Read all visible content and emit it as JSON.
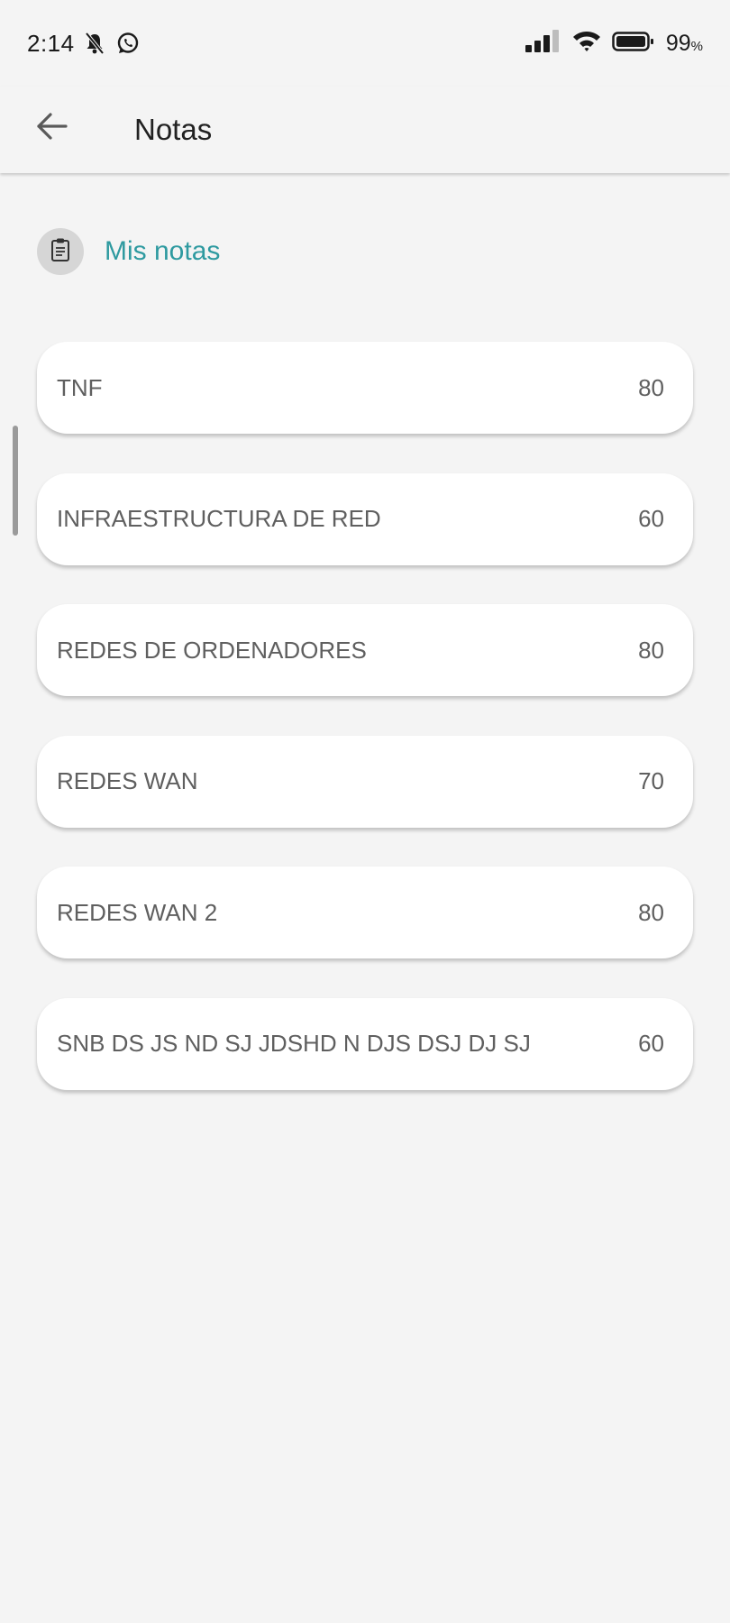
{
  "status_bar": {
    "time": "2:14",
    "battery_value": "99",
    "battery_unit": "%",
    "icons": [
      "bell-off-icon",
      "whatsapp-icon",
      "signal-icon",
      "wifi-icon",
      "battery-icon"
    ]
  },
  "app_bar": {
    "title": "Notas",
    "back_icon": "arrow-left-icon"
  },
  "section": {
    "title": "Mis notas",
    "icon": "clipboard-icon",
    "accent_color": "#2e9aa0"
  },
  "notes": [
    {
      "subject": "TNF",
      "grade": "80"
    },
    {
      "subject": "INFRAESTRUCTURA DE RED",
      "grade": "60"
    },
    {
      "subject": "REDES DE ORDENADORES",
      "grade": "80"
    },
    {
      "subject": "REDES WAN",
      "grade": "70"
    },
    {
      "subject": "REDES WAN 2",
      "grade": "80"
    },
    {
      "subject": "SNB DS JS ND SJ JDSHD N DJS DSJ DJ SJ",
      "grade": "60"
    }
  ]
}
